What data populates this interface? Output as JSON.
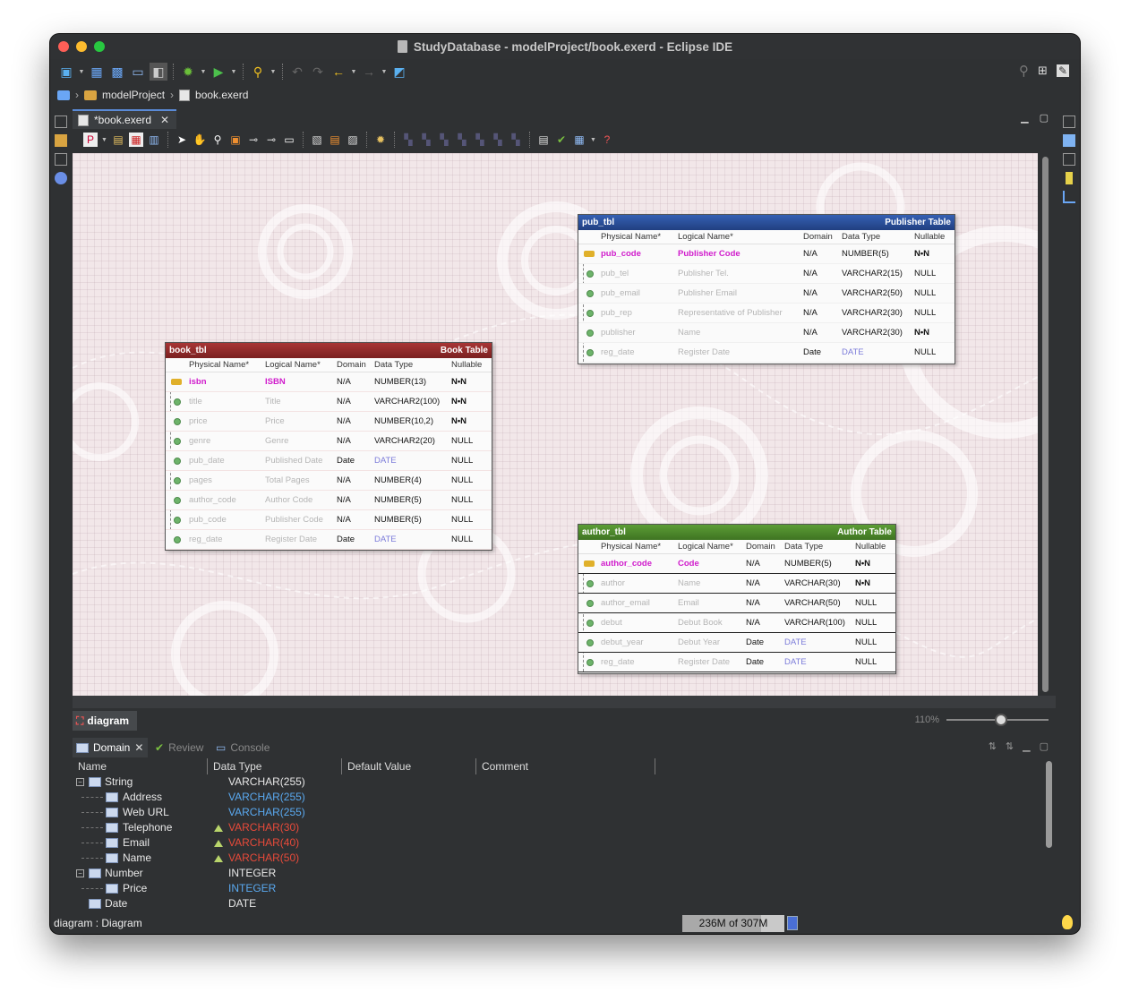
{
  "window": {
    "title": "StudyDatabase - modelProject/book.exerd - Eclipse IDE"
  },
  "breadcrumb": {
    "project": "modelProject",
    "file": "book.exerd"
  },
  "editor_tab": {
    "label": "*book.exerd"
  },
  "colors": {
    "book_header": "#8e2b2b",
    "pub_header": "#2b4f9a",
    "author_header": "#4f8a2f",
    "pk": "#d01ccc"
  },
  "book_tbl": {
    "name": "book_tbl",
    "label": "Book Table",
    "cols": {
      "physical": "Physical Name*",
      "logical": "Logical Name*",
      "domain": "Domain",
      "type": "Data Type",
      "nullable": "Nullable"
    },
    "rows": [
      {
        "p": "isbn",
        "l": "ISBN",
        "d": "N/A",
        "t": "NUMBER(13)",
        "n": "N•N"
      },
      {
        "p": "title",
        "l": "Title",
        "d": "N/A",
        "t": "VARCHAR2(100)",
        "n": "N•N"
      },
      {
        "p": "price",
        "l": "Price",
        "d": "N/A",
        "t": "NUMBER(10,2)",
        "n": "N•N"
      },
      {
        "p": "genre",
        "l": "Genre",
        "d": "N/A",
        "t": "VARCHAR2(20)",
        "n": "NULL"
      },
      {
        "p": "pub_date",
        "l": "Published Date",
        "d": "Date",
        "t": "DATE",
        "n": "NULL"
      },
      {
        "p": "pages",
        "l": "Total Pages",
        "d": "N/A",
        "t": "NUMBER(4)",
        "n": "NULL"
      },
      {
        "p": "author_code",
        "l": "Author Code",
        "d": "N/A",
        "t": "NUMBER(5)",
        "n": "NULL"
      },
      {
        "p": "pub_code",
        "l": "Publisher Code",
        "d": "N/A",
        "t": "NUMBER(5)",
        "n": "NULL"
      },
      {
        "p": "reg_date",
        "l": "Register Date",
        "d": "Date",
        "t": "DATE",
        "n": "NULL"
      }
    ]
  },
  "pub_tbl": {
    "name": "pub_tbl",
    "label": "Publisher Table",
    "cols": {
      "physical": "Physical Name*",
      "logical": "Logical Name*",
      "domain": "Domain",
      "type": "Data Type",
      "nullable": "Nullable"
    },
    "rows": [
      {
        "p": "pub_code",
        "l": "Publisher Code",
        "d": "N/A",
        "t": "NUMBER(5)",
        "n": "N•N"
      },
      {
        "p": "pub_tel",
        "l": "Publisher Tel.",
        "d": "N/A",
        "t": "VARCHAR2(15)",
        "n": "NULL"
      },
      {
        "p": "pub_email",
        "l": "Publisher Email",
        "d": "N/A",
        "t": "VARCHAR2(50)",
        "n": "NULL"
      },
      {
        "p": "pub_rep",
        "l": "Representative of Publisher",
        "d": "N/A",
        "t": "VARCHAR2(30)",
        "n": "NULL"
      },
      {
        "p": "publisher",
        "l": "Name",
        "d": "N/A",
        "t": "VARCHAR2(30)",
        "n": "N•N"
      },
      {
        "p": "reg_date",
        "l": "Register Date",
        "d": "Date",
        "t": "DATE",
        "n": "NULL"
      }
    ]
  },
  "author_tbl": {
    "name": "author_tbl",
    "label": "Author Table",
    "cols": {
      "physical": "Physical Name*",
      "logical": "Logical Name*",
      "domain": "Domain",
      "type": "Data Type",
      "nullable": "Nullable"
    },
    "rows": [
      {
        "p": "author_code",
        "l": "Code",
        "d": "N/A",
        "t": "NUMBER(5)",
        "n": "N•N"
      },
      {
        "p": "author",
        "l": "Name",
        "d": "N/A",
        "t": "VARCHAR(30)",
        "n": "N•N"
      },
      {
        "p": "author_email",
        "l": "Email",
        "d": "N/A",
        "t": "VARCHAR(50)",
        "n": "NULL"
      },
      {
        "p": "debut",
        "l": "Debut Book",
        "d": "N/A",
        "t": "VARCHAR(100)",
        "n": "NULL"
      },
      {
        "p": "debut_year",
        "l": "Debut Year",
        "d": "Date",
        "t": "DATE",
        "n": "NULL"
      },
      {
        "p": "reg_date",
        "l": "Register Date",
        "d": "Date",
        "t": "DATE",
        "n": "NULL"
      }
    ]
  },
  "diagram_tab": {
    "label": "diagram",
    "zoom": "110%"
  },
  "bottom_tabs": {
    "domain": "Domain",
    "review": "Review",
    "console": "Console"
  },
  "domain_grid": {
    "headers": {
      "name": "Name",
      "type": "Data Type",
      "default": "Default Value",
      "comment": "Comment"
    },
    "rows": [
      {
        "name": "String",
        "type": "VARCHAR(255)"
      },
      {
        "name": "Address",
        "type": "VARCHAR(255)"
      },
      {
        "name": "Web URL",
        "type": "VARCHAR(255)"
      },
      {
        "name": "Telephone",
        "type": "VARCHAR(30)"
      },
      {
        "name": "Email",
        "type": "VARCHAR(40)"
      },
      {
        "name": "Name",
        "type": "VARCHAR(50)"
      },
      {
        "name": "Number",
        "type": "INTEGER"
      },
      {
        "name": "Price",
        "type": "INTEGER"
      },
      {
        "name": "Date",
        "type": "DATE"
      }
    ]
  },
  "status": {
    "left": "diagram : Diagram",
    "heap": "236M of 307M",
    "heap_fraction": 0.77
  }
}
